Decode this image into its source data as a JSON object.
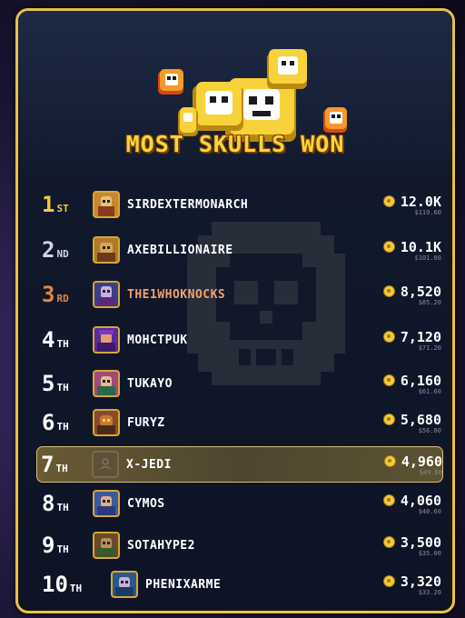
{
  "leaderboard": {
    "title": "MOST SKULLS WON",
    "entries": [
      {
        "rank": "1",
        "suffix": "ST",
        "name": "SIRDEXTERMONARCH",
        "amount": "12.0K",
        "usd": "$119.60",
        "avatar": "knight-hero-avatar"
      },
      {
        "rank": "2",
        "suffix": "ND",
        "name": "AXEBILLIONAIRE",
        "amount": "10.1K",
        "usd": "$101.00",
        "avatar": "axe-hero-avatar"
      },
      {
        "rank": "3",
        "suffix": "RD",
        "name": "THE1WHOKNOCKS",
        "amount": "8,520",
        "usd": "$85.20",
        "avatar": "mage-hero-avatar"
      },
      {
        "rank": "4",
        "suffix": "TH",
        "name": "MOHCTPUK",
        "amount": "7,120",
        "usd": "$71.20",
        "avatar": "sorcerer-hero-avatar"
      },
      {
        "rank": "5",
        "suffix": "TH",
        "name": "TUKAYO",
        "amount": "6,160",
        "usd": "$61.60",
        "avatar": "rogue-hero-avatar"
      },
      {
        "rank": "6",
        "suffix": "TH",
        "name": "FURYZ",
        "amount": "5,680",
        "usd": "$56.80",
        "avatar": "beast-hero-avatar"
      },
      {
        "rank": "7",
        "suffix": "TH",
        "name": "X-JEDI",
        "amount": "4,960",
        "usd": "$49.60",
        "avatar": "default-user-avatar"
      },
      {
        "rank": "8",
        "suffix": "TH",
        "name": "CYMOS",
        "amount": "4,060",
        "usd": "$40.60",
        "avatar": "warrior-hero-avatar"
      },
      {
        "rank": "9",
        "suffix": "TH",
        "name": "SOTAHYPE2",
        "amount": "3,500",
        "usd": "$35.00",
        "avatar": "ranger-hero-avatar"
      },
      {
        "rank": "10",
        "suffix": "TH",
        "name": "PHENIXARME",
        "amount": "3,320",
        "usd": "$33.20",
        "avatar": "phoenix-hero-avatar"
      }
    ]
  },
  "colors": {
    "border": "#e6c24a",
    "gold": "#f3c93d",
    "silver": "#d7d3e0",
    "bronze": "#e0864a",
    "highlight": "#6a5a35"
  }
}
